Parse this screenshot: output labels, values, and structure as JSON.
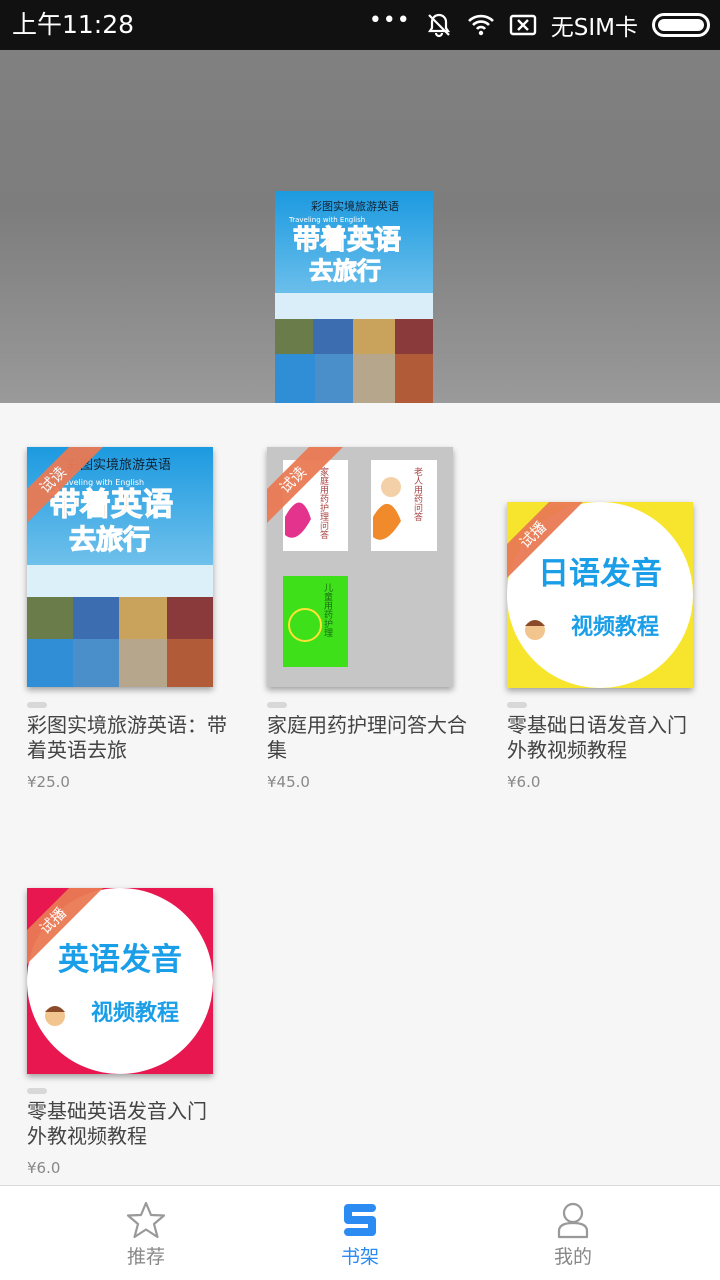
{
  "status_bar": {
    "time": "上午11:28",
    "dots": "•••",
    "carrier": "无SIM卡",
    "icons": [
      "bell-off-icon",
      "wifi-icon",
      "no-sim-icon",
      "battery-icon"
    ]
  },
  "header": {
    "featured_book": {
      "series": "彩图实境旅游英语",
      "subtitle": "Traveling with English",
      "title_line1": "带着英语",
      "title_line2": "去旅行"
    }
  },
  "books": [
    {
      "badge": "试读",
      "title": "彩图实境旅游英语：带着英语去旅",
      "price": "¥25.0",
      "cover": {
        "series": "彩图实境旅游英语",
        "subtitle": "Traveling with English",
        "line1": "带着英语",
        "line2": "去旅行"
      }
    },
    {
      "badge": "试读",
      "title": "家庭用药护理问答大合集",
      "price": "¥45.0",
      "cover": {
        "mini1": "家庭用药护理问答",
        "mini2": "老人用药问答",
        "mini3": "儿童用药护理"
      }
    },
    {
      "badge": "试播",
      "title": "零基础日语发音入门外教视频教程",
      "price": "¥6.0",
      "cover": {
        "line1": "日语发音",
        "line2": "视频教程",
        "bg": "#f7e52d"
      }
    },
    {
      "badge": "试播",
      "title": "零基础英语发音入门外教视频教程",
      "price": "¥6.0",
      "cover": {
        "line1": "英语发音",
        "line2": "视频教程",
        "bg": "#e8174f"
      }
    }
  ],
  "nav": {
    "items": [
      {
        "label": "推荐",
        "icon": "star-icon"
      },
      {
        "label": "书架",
        "icon": "bookshelf-icon"
      },
      {
        "label": "我的",
        "icon": "user-icon"
      }
    ],
    "active_color": "#2a8bf2",
    "inactive_color": "#888888"
  }
}
